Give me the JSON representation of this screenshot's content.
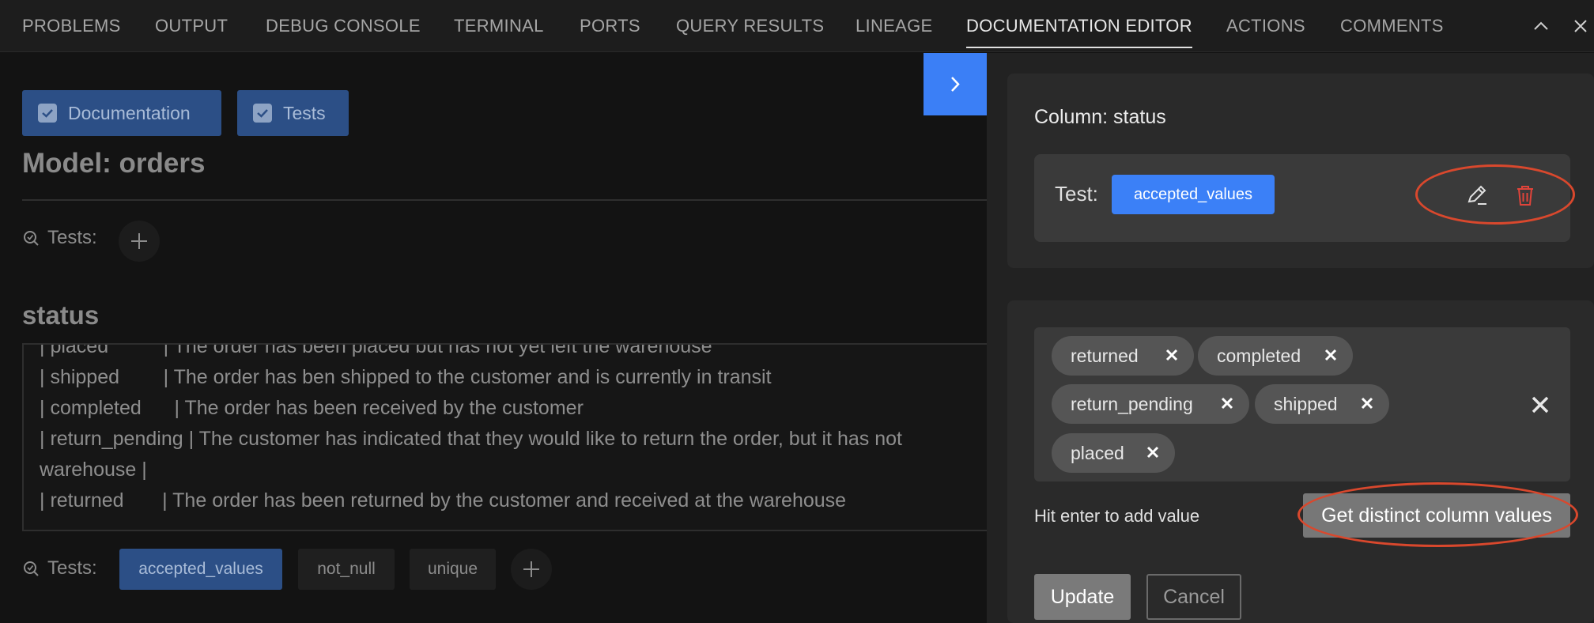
{
  "tabs": [
    "PROBLEMS",
    "OUTPUT",
    "DEBUG CONSOLE",
    "TERMINAL",
    "PORTS",
    "QUERY RESULTS",
    "LINEAGE",
    "DOCUMENTATION EDITOR",
    "ACTIONS",
    "COMMENTS"
  ],
  "active_tab": "DOCUMENTATION EDITOR",
  "window_icons": [
    "chevron-up-icon",
    "close-icon"
  ],
  "left": {
    "toggles": [
      {
        "label": "Documentation",
        "checked": true
      },
      {
        "label": "Tests",
        "checked": true
      }
    ],
    "model_title": "Model: orders",
    "tests_label": "Tests:",
    "column_title": "status",
    "description_lines": [
      "| placed          | The order has been placed but has not yet left the warehouse",
      "| shipped        | The order has ben shipped to the customer and is currently in transit",
      "| completed      | The order has been received by the customer",
      "| return_pending | The customer has indicated that they would like to return the order, but it has not",
      "warehouse |",
      "| returned       | The order has been returned by the customer and received at the warehouse"
    ],
    "column_tests": [
      "accepted_values",
      "not_null",
      "unique"
    ]
  },
  "panel": {
    "column_label": "Column: status",
    "test_label": "Test:",
    "test_name": "accepted_values",
    "values": [
      "returned",
      "completed",
      "return_pending",
      "shipped",
      "placed"
    ],
    "hint": "Hit enter to add value",
    "distinct_button": "Get distinct column values",
    "update_button": "Update",
    "cancel_button": "Cancel"
  },
  "colors": {
    "accent": "#3b80f7",
    "annotation": "#d9482d",
    "delete": "#e0443a"
  }
}
